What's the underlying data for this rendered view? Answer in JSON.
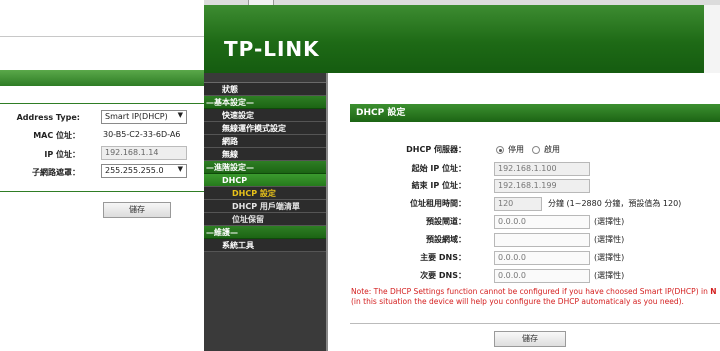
{
  "back_window": {
    "address_type_label": "Address Type:",
    "address_type_value": "Smart IP(DHCP)",
    "mac_label": "MAC 位址：",
    "mac_value": "30-B5-C2-33-6D-A6",
    "ip_label": "IP 位址：",
    "ip_value": "192.168.1.14",
    "subnet_label": "子網路遮罩：",
    "subnet_value": "255.255.255.0",
    "save_label": "儲存"
  },
  "header": {
    "logo": "TP-LINK"
  },
  "sidebar": {
    "items": [
      {
        "label": "狀態",
        "kind": "item"
      },
      {
        "label": "—基本設定—",
        "kind": "grp"
      },
      {
        "label": "快速設定",
        "kind": "item"
      },
      {
        "label": "無線運作模式設定",
        "kind": "item"
      },
      {
        "label": "網路",
        "kind": "item"
      },
      {
        "label": "無線",
        "kind": "item"
      },
      {
        "label": "—進階設定—",
        "kind": "grp"
      },
      {
        "label": "DHCP",
        "kind": "sel"
      },
      {
        "label": "DHCP 設定",
        "kind": "sub-active"
      },
      {
        "label": "DHCP 用戶端清單",
        "kind": "sub"
      },
      {
        "label": "位址保留",
        "kind": "sub"
      },
      {
        "label": "—維護—",
        "kind": "grp"
      },
      {
        "label": "系統工具",
        "kind": "item"
      }
    ]
  },
  "content": {
    "title": "DHCP 設定",
    "server_label": "DHCP 伺服器：",
    "server_disable": "停用",
    "server_enable": "啟用",
    "start_label": "起始 IP 位址：",
    "start_value": "192.168.1.100",
    "end_label": "結束 IP 位址：",
    "end_value": "192.168.1.199",
    "lease_label": "位址租用時間：",
    "lease_value": "120",
    "lease_note": "分鐘 (1~2880 分鐘，預設值為 120)",
    "gateway_label": "預設閘道：",
    "gateway_value": "0.0.0.0",
    "gateway_note": "(選擇性)",
    "domain_label": "預設網域：",
    "domain_value": "",
    "domain_note": "(選擇性)",
    "dns1_label": "主要 DNS：",
    "dns1_value": "0.0.0.0",
    "dns1_note": "(選擇性)",
    "dns2_label": "次要 DNS：",
    "dns2_value": "0.0.0.0",
    "dns2_note": "(選擇性)",
    "note_line1": "Note: The DHCP Settings function cannot be configured if you have choosed Smart IP(DHCP) in ",
    "note_line1_bold": "N",
    "note_line2": "(in this situation the device will help you configure the DHCP automaticaly as you need).",
    "save_label": "儲存"
  }
}
